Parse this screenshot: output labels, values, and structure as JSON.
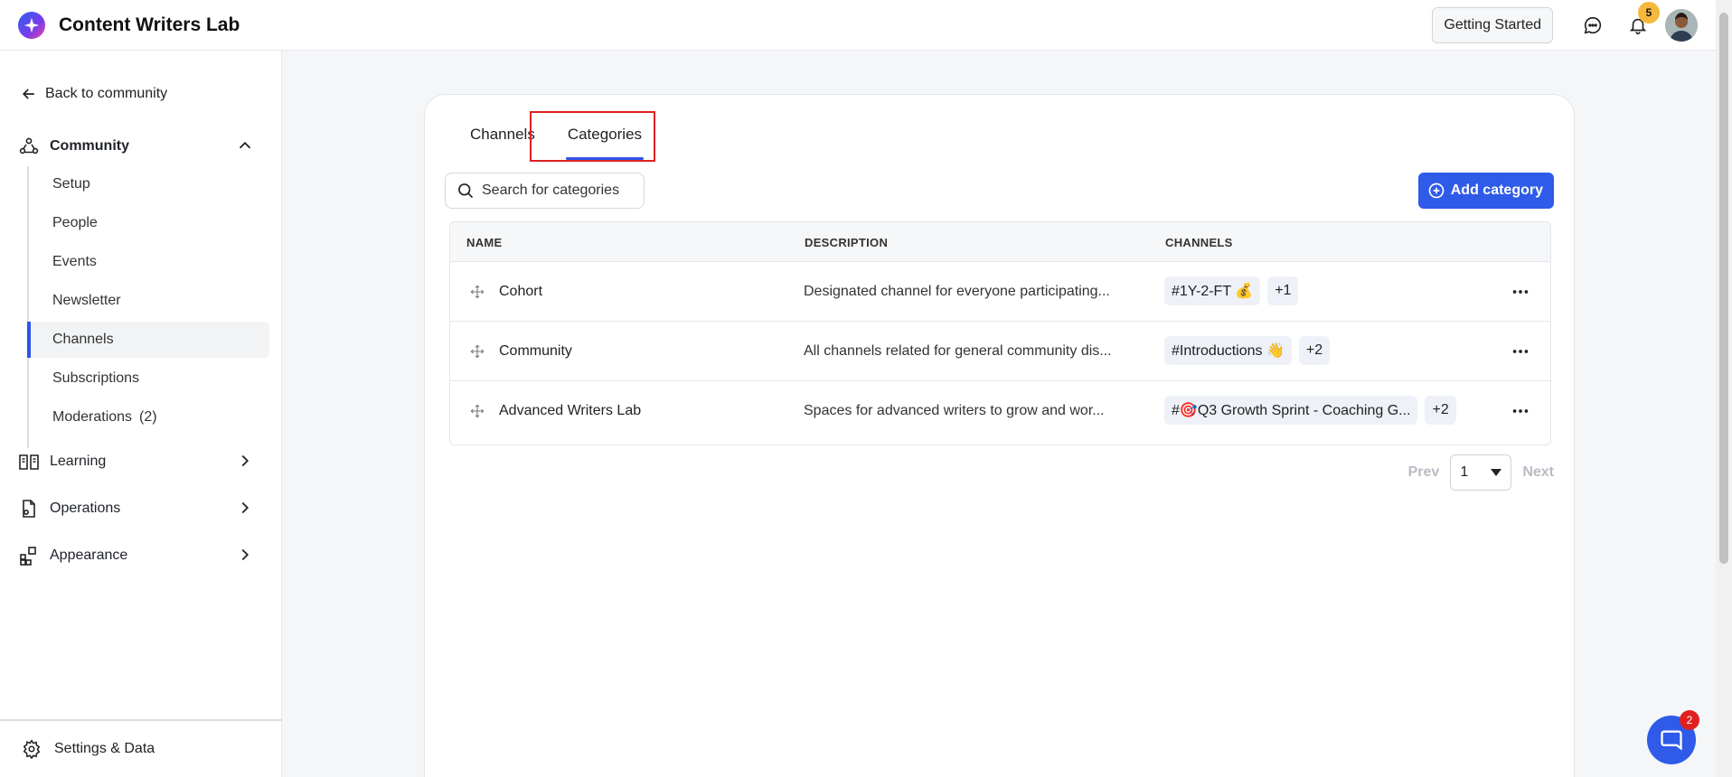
{
  "app": {
    "title": "Content Writers Lab",
    "accent_color": "#2f5be8"
  },
  "topbar": {
    "getting_started_label": "Getting Started",
    "notifications_count": "5",
    "icons": [
      "chat-bubble-icon",
      "bell-icon",
      "avatar"
    ]
  },
  "sidebar": {
    "back_label": "Back to community",
    "community_label": "Community",
    "community_items": [
      {
        "label": "Setup"
      },
      {
        "label": "People"
      },
      {
        "label": "Events"
      },
      {
        "label": "Newsletter"
      },
      {
        "label": "Channels",
        "active": true
      },
      {
        "label": "Subscriptions"
      },
      {
        "label": "Moderations",
        "count": "(2)"
      }
    ],
    "learning_label": "Learning",
    "operations_label": "Operations",
    "appearance_label": "Appearance",
    "settings_label": "Settings & Data"
  },
  "main": {
    "tabs": [
      {
        "label": "Channels",
        "active": false
      },
      {
        "label": "Categories",
        "active": true
      }
    ],
    "search_placeholder": "Search for categories",
    "add_button_label": "Add category",
    "table": {
      "headers": {
        "name": "NAME",
        "description": "DESCRIPTION",
        "channels": "CHANNELS"
      },
      "rows": [
        {
          "name": "Cohort",
          "description": "Designated channel for everyone participating...",
          "channel_chip": "#1Y-2-FT 💰",
          "more_chip": "+1"
        },
        {
          "name": "Community",
          "description": "All channels related for general community dis...",
          "channel_chip": "#Introductions 👋",
          "more_chip": "+2"
        },
        {
          "name": "Advanced Writers Lab",
          "description": "Spaces for advanced writers to grow and wor...",
          "channel_chip": "#🎯Q3 Growth Sprint - Coaching G...",
          "more_chip": "+2"
        }
      ]
    },
    "pagination": {
      "prev_label": "Prev",
      "page_value": "1",
      "next_label": "Next"
    }
  },
  "chat_widget": {
    "badge_count": "2"
  }
}
